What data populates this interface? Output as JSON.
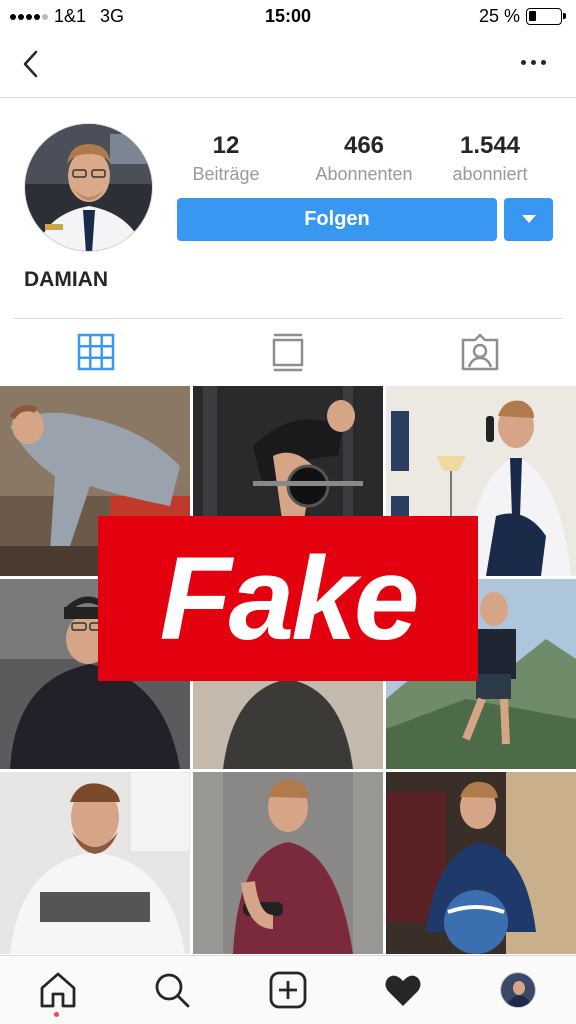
{
  "status_bar": {
    "carrier": "1&1",
    "network": "3G",
    "time": "15:00",
    "battery": "25 %",
    "battery_level": 0.25
  },
  "profile": {
    "name": "DAMIAN",
    "stats": [
      {
        "value": "12",
        "label": "Beiträge"
      },
      {
        "value": "466",
        "label": "Abonnenten"
      },
      {
        "value": "1.544",
        "label": "abonniert"
      }
    ],
    "follow_label": "Folgen"
  },
  "tabs": [
    {
      "icon": "grid-icon",
      "active": true
    },
    {
      "icon": "feed-icon",
      "active": false
    },
    {
      "icon": "tagged-icon",
      "active": false
    }
  ],
  "overlay": {
    "label": "Fake",
    "color": "#e3000f"
  },
  "colors": {
    "accent": "#3897f0",
    "text": "#262626",
    "secondary_text": "#999999"
  },
  "bottom_nav": [
    {
      "icon": "home-icon"
    },
    {
      "icon": "search-icon"
    },
    {
      "icon": "add-icon"
    },
    {
      "icon": "heart-icon"
    },
    {
      "icon": "profile-avatar-icon"
    }
  ]
}
